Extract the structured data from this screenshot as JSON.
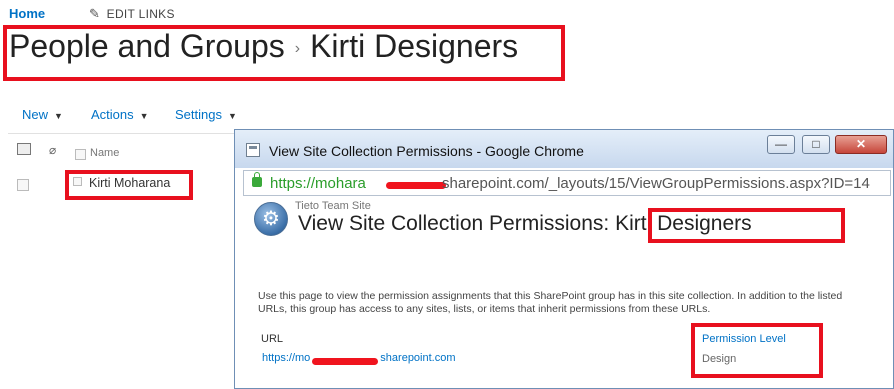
{
  "topnav": {
    "home": "Home",
    "edit_links": "EDIT LINKS"
  },
  "page": {
    "breadcrumb_parent": "People and Groups",
    "separator": "›",
    "group_name": "Kirti Designers"
  },
  "toolbar": {
    "new": "New",
    "actions": "Actions",
    "settings": "Settings"
  },
  "list": {
    "name_header": "Name",
    "rows": [
      {
        "name": "Kirti Moharana"
      }
    ]
  },
  "popup": {
    "window_title": "View Site Collection Permissions - Google Chrome",
    "address_https": "https://mohara",
    "address_rest": "sharepoint.com/_layouts/15/ViewGroupPermissions.aspx?ID=14",
    "site_name": "Tieto Team Site",
    "heading_prefix": "View Site Collection Permissions:",
    "heading_group": "Kirti Designers",
    "description": "Use this page to view the permission assignments that this SharePoint group has in this site collection. In addition to the listed URLs, this group has access to any sites, lists, or items that inherit permissions from these URLs.",
    "col_url": "URL",
    "col_permission": "Permission Level",
    "row_url_start": "https://mo",
    "row_url_end": "sharepoint.com",
    "row_permission": "Design",
    "buttons": {
      "minimize": "—",
      "maximize": "□",
      "close": "✕"
    }
  },
  "colors": {
    "accent": "#0072c6",
    "highlight": "#e8101e",
    "secure": "#2a9d2a"
  }
}
